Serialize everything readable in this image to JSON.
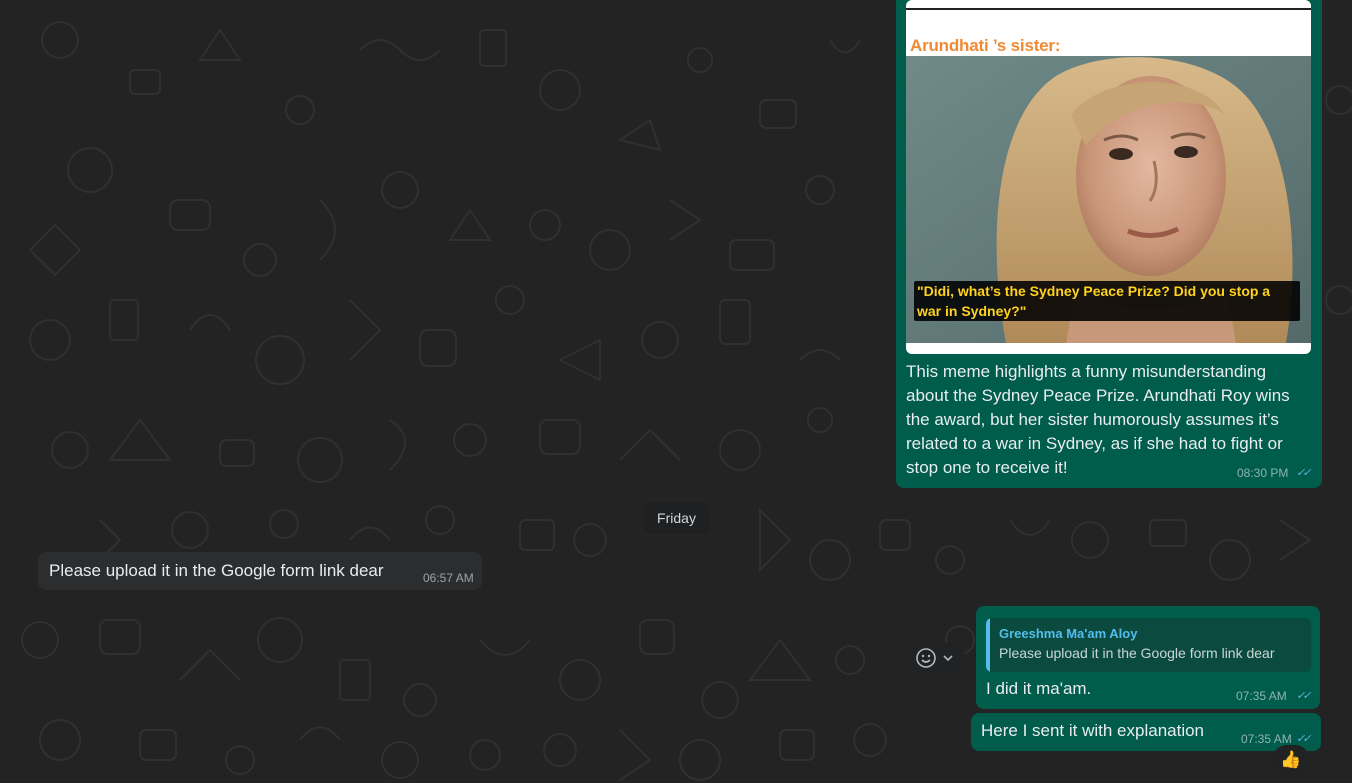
{
  "meme_message": {
    "heading": "Arundhati ’s sister:",
    "caption": "\"Didi, what’s the Sydney Peace Prize? Did you stop a war in Sydney?\"",
    "text": "This meme highlights a funny misunderstanding about the Sydney Peace Prize. Arundhati Roy wins the award, but her sister humorously assumes it’s related to a war in Sydney, as if she had to fight or stop one to receive it!",
    "time": "08:30 PM",
    "status_icon": "double-check-icon"
  },
  "date_separator": "Friday",
  "incoming_message": {
    "text": "Please upload it in the Google form link dear",
    "time": "06:57 AM"
  },
  "reply_message": {
    "quoted_author": "Greeshma Ma'am Aloy",
    "quoted_text": "Please upload it in the Google form link dear",
    "text": "I did it ma'am.",
    "time": "07:35 AM",
    "status_icon": "double-check-icon"
  },
  "last_message": {
    "text": "Here I sent it with explanation",
    "time": "07:35 AM",
    "status_icon": "double-check-icon",
    "reaction": "👍"
  },
  "colors": {
    "outgoing_bubble": "#005c4b",
    "incoming_bubble": "#2b2d2e",
    "background": "#222322",
    "read_ticks": "#53bdeb",
    "meme_heading": "#f08a33",
    "meme_caption": "#ffd21f"
  }
}
